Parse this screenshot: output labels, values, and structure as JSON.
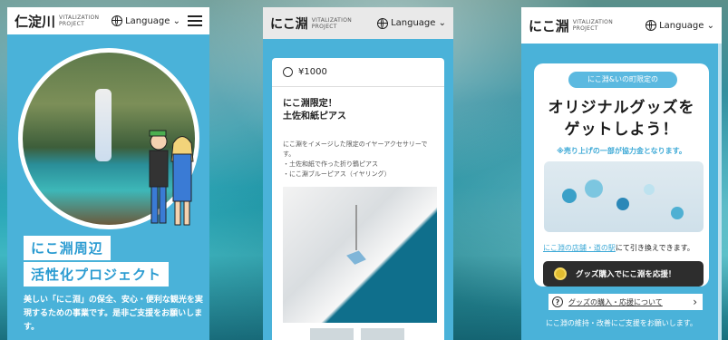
{
  "screen1": {
    "logo": "仁淀川",
    "logo_sub1": "VITALIZATION",
    "logo_sub2": "PROJECT",
    "language": "Language ⌄",
    "title_line1": "にこ淵周辺",
    "title_line2": "活性化プロジェクト",
    "body": "美しい「にこ淵」の保全、安心・便利な観光を実現するための事業です。是非ご支援をお願いします。"
  },
  "screen2": {
    "logo": "にこ淵",
    "logo_sub1": "VITALIZATION",
    "logo_sub2": "PROJECT",
    "language": "Language ⌄",
    "price": "¥1000",
    "product_title_1": "にこ淵限定！",
    "product_title_2": "土佐和紙ピアス",
    "desc_1": "にこ淵をイメージした限定のイヤーアクセサリーです。",
    "desc_2": "・土佐和紙で作った折り鶴ピアス",
    "desc_3": "・にこ淵ブルーピアス（イヤリング）"
  },
  "screen3": {
    "logo": "にこ淵",
    "logo_sub1": "VITALIZATION",
    "logo_sub2": "PROJECT",
    "language": "Language ⌄",
    "pill": "にこ淵&いの町限定の",
    "heading_1": "オリジナルグッズを",
    "heading_2": "ゲットしよう！",
    "note": "※売り上げの一部が協力金となります。",
    "shop_link": "にこ淵の店舗・道の駅",
    "shop_rest": "にて引き換えできます。",
    "cta": "グッズ購入でにこ淵を応援！",
    "help": "グッズの購入・応援について",
    "help_q": "?",
    "help_arrow": "›",
    "footer": "にこ淵の維持・改善にご支援をお願いします。"
  }
}
